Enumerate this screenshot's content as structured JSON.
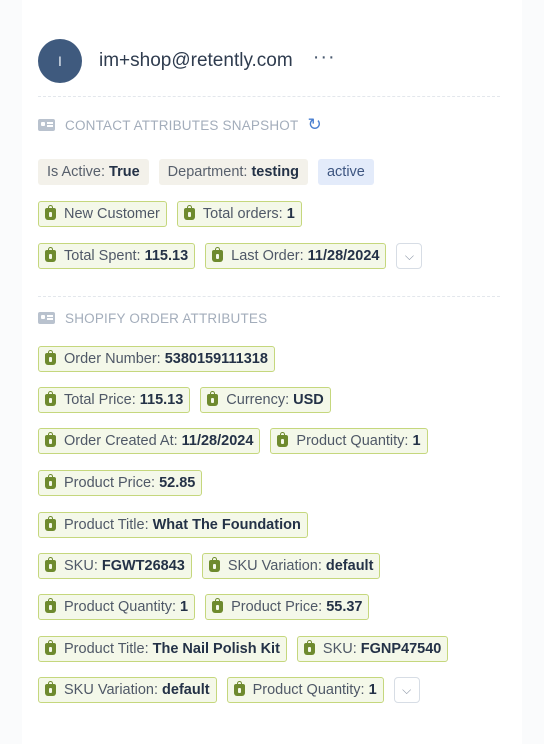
{
  "header": {
    "avatar_initial": "I",
    "email": "im+shop@retently.com",
    "more": "···"
  },
  "contact_section": {
    "title": "CONTACT ATTRIBUTES SNAPSHOT",
    "refresh_icon": "↻",
    "plain_chips": [
      {
        "label": "Is Active:",
        "value": "True"
      },
      {
        "label": "Department:",
        "value": "testing"
      }
    ],
    "tag": "active",
    "shopify_chips": [
      {
        "label": "New Customer",
        "value": ""
      },
      {
        "label": "Total orders:",
        "value": "1"
      },
      {
        "label": "Total Spent:",
        "value": "115.13"
      },
      {
        "label": "Last Order:",
        "value": "11/28/2024"
      }
    ]
  },
  "order_section": {
    "title": "SHOPIFY ORDER ATTRIBUTES",
    "chips": [
      {
        "label": "Order Number:",
        "value": "5380159111318"
      },
      {
        "label": "Total Price:",
        "value": "115.13"
      },
      {
        "label": "Currency:",
        "value": "USD"
      },
      {
        "label": "Order Created At:",
        "value": "11/28/2024"
      },
      {
        "label": "Product Quantity:",
        "value": "1"
      },
      {
        "label": "Product Price:",
        "value": "52.85"
      },
      {
        "label": "Product Title:",
        "value": "What The Foundation"
      },
      {
        "label": "SKU:",
        "value": "FGWT26843"
      },
      {
        "label": "SKU Variation:",
        "value": "default"
      },
      {
        "label": "Product Quantity:",
        "value": "1"
      },
      {
        "label": "Product Price:",
        "value": "55.37"
      },
      {
        "label": "Product Title:",
        "value": "The Nail Polish Kit"
      },
      {
        "label": "SKU:",
        "value": "FGNP47540"
      },
      {
        "label": "SKU Variation:",
        "value": "default"
      },
      {
        "label": "Product Quantity:",
        "value": "1"
      }
    ]
  },
  "icons": {
    "expand": "chevron-down-icon",
    "shopify": "shopify-bag-icon",
    "section": "contact-card-icon"
  },
  "colors": {
    "accent_blue": "#4a7fd0",
    "shopify_border": "#c5d77d",
    "shopify_bg": "#f4f8e9",
    "avatar": "#3f5a7e"
  }
}
